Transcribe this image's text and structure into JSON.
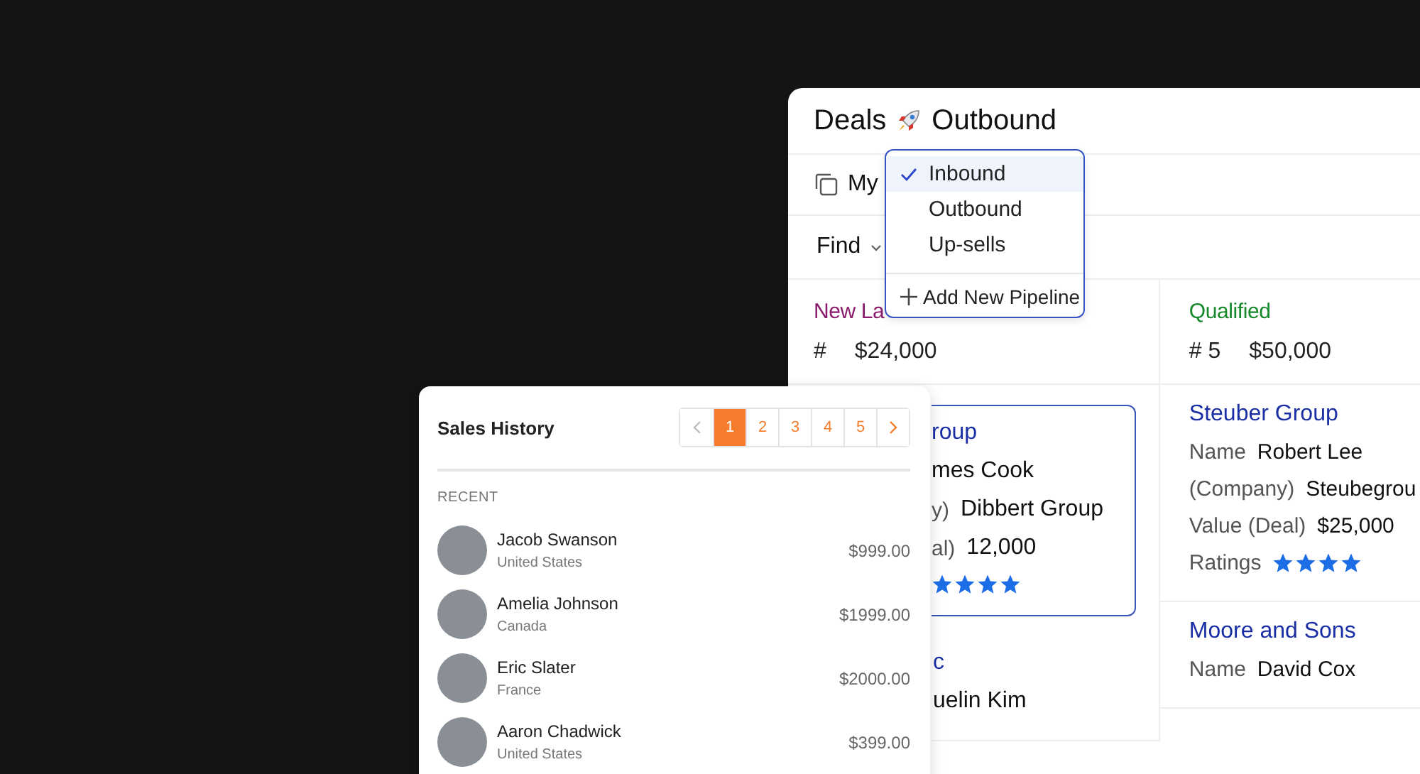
{
  "deals": {
    "title": "Deals",
    "pipeline": "Outbound",
    "view": "My",
    "find": "Find",
    "pipeline_menu": {
      "items": [
        {
          "label": "Inbound",
          "selected": true
        },
        {
          "label": "Outbound",
          "selected": false
        },
        {
          "label": "Up-sells",
          "selected": false
        }
      ],
      "add": "Add New Pipeline"
    },
    "columns": [
      {
        "title": "New La",
        "color": "#8a1b6c",
        "count": "#",
        "total": "$24,000",
        "cards": [
          {
            "title": "roup",
            "selected": true,
            "fields": [
              {
                "kind": "text",
                "value": "mes Cook"
              },
              {
                "kind": "text",
                "label": "y)",
                "value": "Dibbert Group"
              },
              {
                "kind": "text",
                "label": "al)",
                "value": "12,000"
              },
              {
                "kind": "rating",
                "stars": 4
              }
            ]
          },
          {
            "title": "c",
            "selected": false,
            "fields": [
              {
                "kind": "text",
                "value": "uelin Kim"
              }
            ]
          }
        ]
      },
      {
        "title": "Qualified",
        "color": "#16892b",
        "count": "# 5",
        "total": "$50,000",
        "cards": [
          {
            "title": "Steuber Group",
            "selected": false,
            "fields": [
              {
                "kind": "text",
                "label": "Name",
                "value": "Robert Lee"
              },
              {
                "kind": "text",
                "label": "(Company)",
                "value": "Steubegrou"
              },
              {
                "kind": "text",
                "label": "Value (Deal)",
                "value": "$25,000"
              },
              {
                "kind": "rating",
                "label": "Ratings",
                "stars": 4
              }
            ]
          },
          {
            "title": "Moore and Sons",
            "selected": false,
            "fields": [
              {
                "kind": "text",
                "label": "Name",
                "value": "David Cox"
              }
            ]
          }
        ]
      }
    ]
  },
  "sales_history": {
    "title": "Sales History",
    "pages": [
      {
        "label": "1",
        "selected": true
      },
      {
        "label": "2",
        "selected": false
      },
      {
        "label": "3",
        "selected": false
      },
      {
        "label": "4",
        "selected": false
      },
      {
        "label": "5",
        "selected": false
      }
    ],
    "section": "RECENT",
    "rows": [
      {
        "name": "Jacob Swanson",
        "country": "United States",
        "amount": "$999.00"
      },
      {
        "name": "Amelia Johnson",
        "country": "Canada",
        "amount": "$1999.00"
      },
      {
        "name": "Eric Slater",
        "country": "France",
        "amount": "$2000.00"
      },
      {
        "name": "Aaron Chadwick",
        "country": "United States",
        "amount": "$399.00"
      }
    ]
  }
}
